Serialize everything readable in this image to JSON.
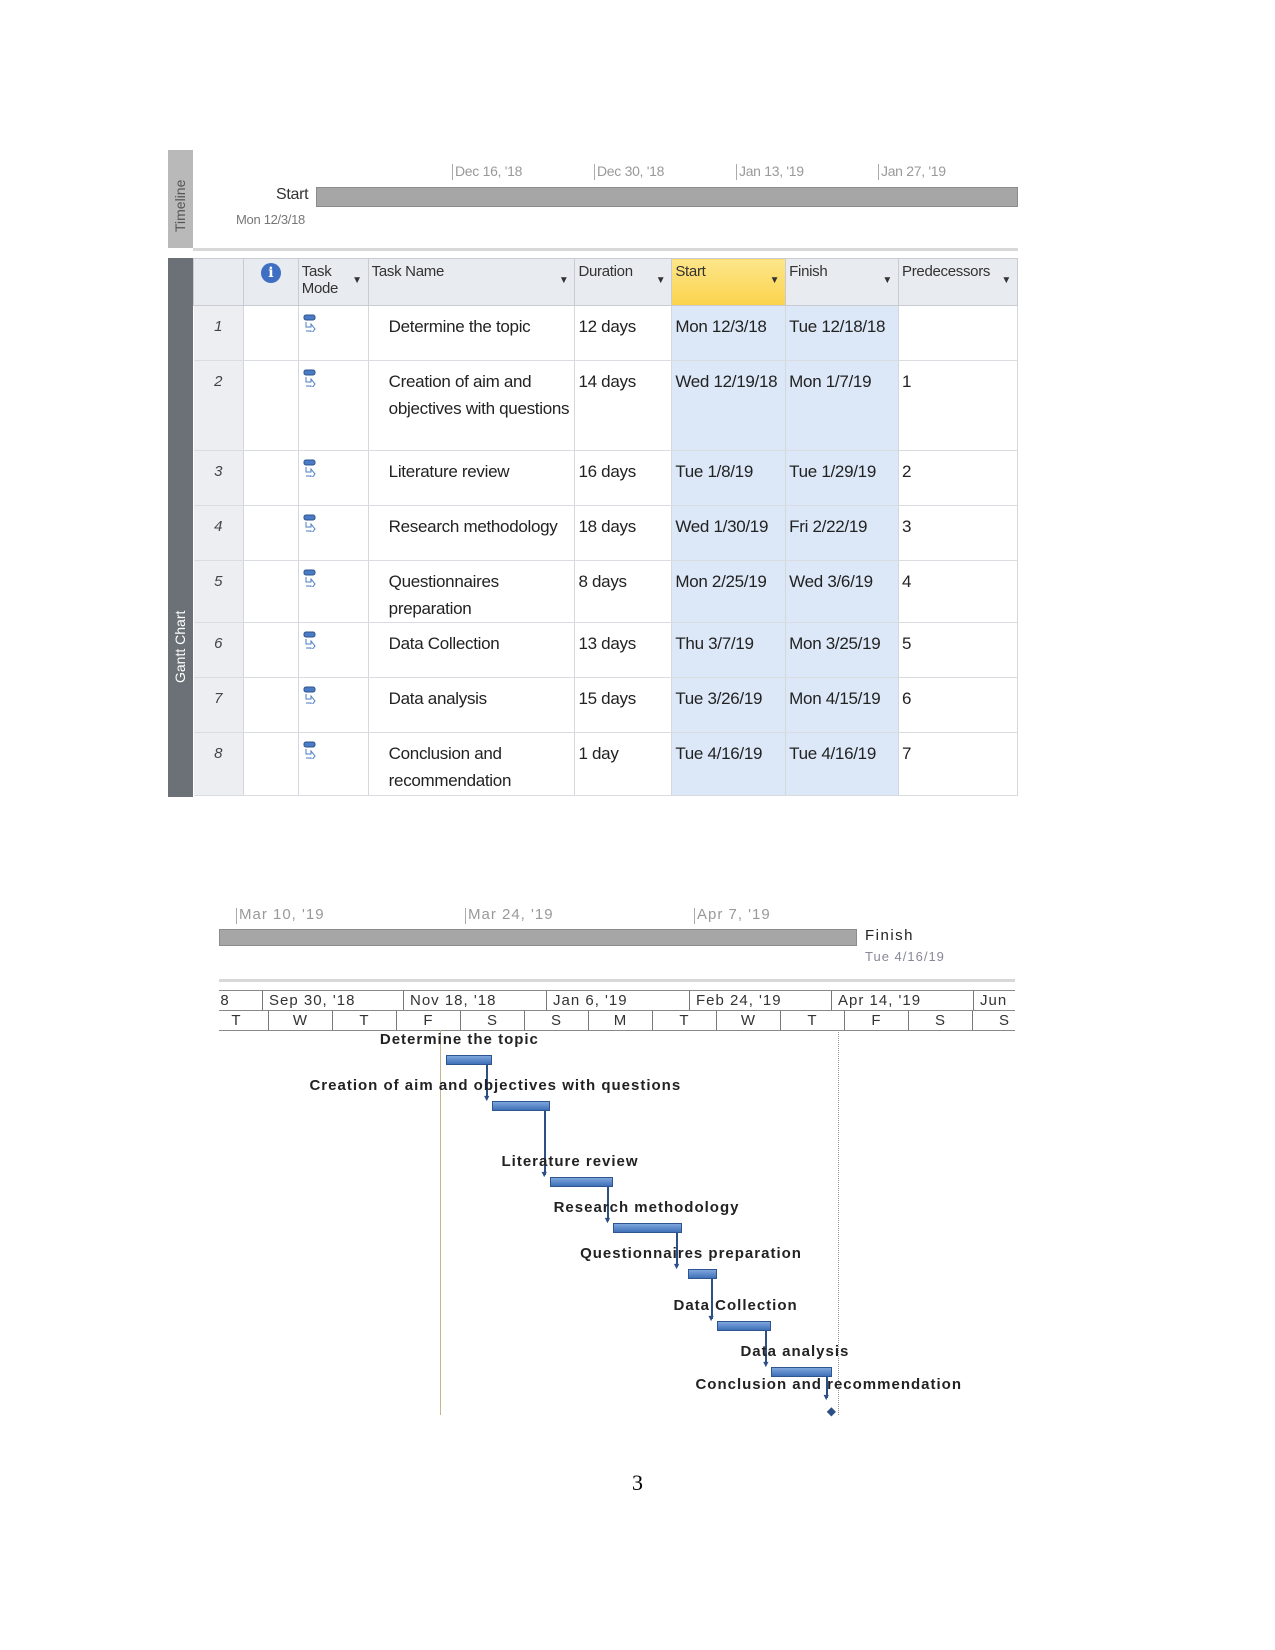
{
  "timeline": {
    "label": "Timeline",
    "start_label": "Start",
    "start_date": "Mon 12/3/18",
    "ticks": [
      "Dec 16, '18",
      "Dec 30, '18",
      "Jan 13, '19",
      "Jan 27, '19"
    ]
  },
  "table": {
    "side_label": "Gantt Chart",
    "headers": {
      "mode": "Task Mode",
      "name": "Task Name",
      "duration": "Duration",
      "start": "Start",
      "finish": "Finish",
      "pred": "Predecessors"
    },
    "rows": [
      {
        "id": "1",
        "name": "Determine the topic",
        "duration": "12 days",
        "start": "Mon 12/3/18",
        "finish": "Tue 12/18/18",
        "pred": ""
      },
      {
        "id": "2",
        "name": "Creation of aim and objectives with questions",
        "duration": "14 days",
        "start": "Wed 12/19/18",
        "finish": "Mon 1/7/19",
        "pred": "1"
      },
      {
        "id": "3",
        "name": "Literature review",
        "duration": "16 days",
        "start": "Tue 1/8/19",
        "finish": "Tue 1/29/19",
        "pred": "2"
      },
      {
        "id": "4",
        "name": "Research methodology",
        "duration": "18 days",
        "start": "Wed 1/30/19",
        "finish": "Fri 2/22/19",
        "pred": "3"
      },
      {
        "id": "5",
        "name": "Questionnaires preparation",
        "duration": "8 days",
        "start": "Mon 2/25/19",
        "finish": "Wed 3/6/19",
        "pred": "4"
      },
      {
        "id": "6",
        "name": "Data Collection",
        "duration": "13 days",
        "start": "Thu 3/7/19",
        "finish": "Mon 3/25/19",
        "pred": "5"
      },
      {
        "id": "7",
        "name": "Data analysis",
        "duration": "15 days",
        "start": "Tue 3/26/19",
        "finish": "Mon 4/15/19",
        "pred": "6"
      },
      {
        "id": "8",
        "name": "Conclusion and recommendation",
        "duration": "1 day",
        "start": "Tue 4/16/19",
        "finish": "Tue 4/16/19",
        "pred": "7"
      }
    ]
  },
  "timeline2": {
    "ticks": [
      "Mar 10, '19",
      "Mar 24, '19",
      "Apr 7, '19"
    ],
    "finish_label": "Finish",
    "finish_date": "Tue 4/16/19"
  },
  "chart_data": {
    "type": "gantt",
    "scale_top": [
      "18",
      "Sep 30, '18",
      "Nov 18, '18",
      "Jan 6, '19",
      "Feb 24, '19",
      "Apr 14, '19",
      "Jun"
    ],
    "scale_bottom": [
      "T",
      "W",
      "T",
      "F",
      "S",
      "S",
      "M",
      "T",
      "W",
      "T",
      "F",
      "S",
      "S"
    ],
    "tasks": [
      {
        "name": "Determine the topic",
        "start": "2018-12-03",
        "finish": "2018-12-18"
      },
      {
        "name": "Creation of aim and objectives with questions",
        "start": "2018-12-19",
        "finish": "2019-01-07"
      },
      {
        "name": "Literature review",
        "start": "2019-01-08",
        "finish": "2019-01-29"
      },
      {
        "name": "Research methodology",
        "start": "2019-01-30",
        "finish": "2019-02-22"
      },
      {
        "name": "Questionnaires preparation",
        "start": "2019-02-25",
        "finish": "2019-03-06"
      },
      {
        "name": "Data Collection",
        "start": "2019-03-07",
        "finish": "2019-03-25"
      },
      {
        "name": "Data analysis",
        "start": "2019-03-26",
        "finish": "2019-04-15"
      },
      {
        "name": "Conclusion and recommendation",
        "start": "2019-04-16",
        "finish": "2019-04-16",
        "milestone": true
      }
    ],
    "bar_color": "#4a7bc4"
  },
  "page_number": "3"
}
